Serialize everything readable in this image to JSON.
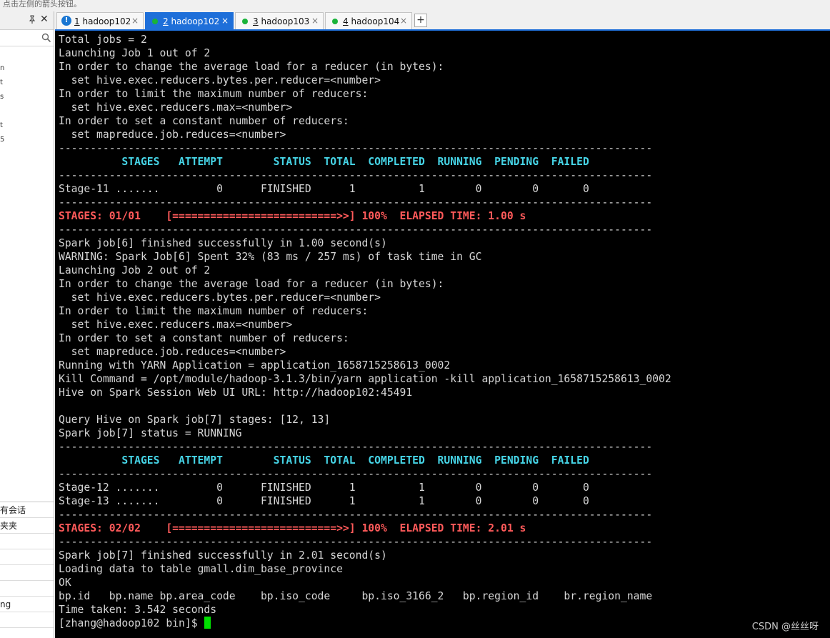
{
  "top_hint": "点击左侧的箭头按钮。",
  "sidebar": {
    "pin_glyph": "📌",
    "close_glyph": "✕",
    "search_icon": "search-icon",
    "side_marks": [
      "n",
      "t",
      "s",
      "",
      "t",
      "5"
    ],
    "bottom_rows": [
      "有会话",
      "夹夹",
      "",
      "",
      "",
      "",
      "ng",
      ""
    ]
  },
  "tabs": [
    {
      "number": "1",
      "name": "hadoop102",
      "status": "warning",
      "active": false
    },
    {
      "number": "2",
      "name": "hadoop102",
      "status": "connected",
      "active": true
    },
    {
      "number": "3",
      "name": "hadoop103",
      "status": "connected",
      "active": false
    },
    {
      "number": "4",
      "name": "hadoop104",
      "status": "connected",
      "active": false
    }
  ],
  "tab_add_label": "+",
  "tab_close_glyph": "×",
  "colors": {
    "terminal_bg": "#000000",
    "terminal_text": "#d6d6d6",
    "header_text": "#46d4e6",
    "progress_text": "#ff5a5a",
    "cursor": "#00e000",
    "active_tab": "#1e6fd9",
    "connected_dot": "#19b33a"
  },
  "terminal": {
    "lines": [
      {
        "text": "Total jobs = 2",
        "style": "normal"
      },
      {
        "text": "Launching Job 1 out of 2",
        "style": "normal"
      },
      {
        "text": "In order to change the average load for a reducer (in bytes):",
        "style": "normal"
      },
      {
        "text": "  set hive.exec.reducers.bytes.per.reducer=<number>",
        "style": "normal"
      },
      {
        "text": "In order to limit the maximum number of reducers:",
        "style": "normal"
      },
      {
        "text": "  set hive.exec.reducers.max=<number>",
        "style": "normal"
      },
      {
        "text": "In order to set a constant number of reducers:",
        "style": "normal"
      },
      {
        "text": "  set mapreduce.job.reduces=<number>",
        "style": "normal"
      },
      {
        "text": "----------------------------------------------------------------------------------------------",
        "style": "normal"
      },
      {
        "text": "          STAGES   ATTEMPT        STATUS  TOTAL  COMPLETED  RUNNING  PENDING  FAILED",
        "style": "head"
      },
      {
        "text": "----------------------------------------------------------------------------------------------",
        "style": "normal"
      },
      {
        "text": "Stage-11 .......         0      FINISHED      1          1        0        0       0",
        "style": "normal"
      },
      {
        "text": "----------------------------------------------------------------------------------------------",
        "style": "normal"
      },
      {
        "text": "STAGES: 01/01    [==========================>>] 100%  ELAPSED TIME: 1.00 s",
        "style": "prog"
      },
      {
        "text": "----------------------------------------------------------------------------------------------",
        "style": "normal"
      },
      {
        "text": "Spark job[6] finished successfully in 1.00 second(s)",
        "style": "normal"
      },
      {
        "text": "WARNING: Spark Job[6] Spent 32% (83 ms / 257 ms) of task time in GC",
        "style": "normal"
      },
      {
        "text": "Launching Job 2 out of 2",
        "style": "normal"
      },
      {
        "text": "In order to change the average load for a reducer (in bytes):",
        "style": "normal"
      },
      {
        "text": "  set hive.exec.reducers.bytes.per.reducer=<number>",
        "style": "normal"
      },
      {
        "text": "In order to limit the maximum number of reducers:",
        "style": "normal"
      },
      {
        "text": "  set hive.exec.reducers.max=<number>",
        "style": "normal"
      },
      {
        "text": "In order to set a constant number of reducers:",
        "style": "normal"
      },
      {
        "text": "  set mapreduce.job.reduces=<number>",
        "style": "normal"
      },
      {
        "text": "Running with YARN Application = application_1658715258613_0002",
        "style": "normal"
      },
      {
        "text": "Kill Command = /opt/module/hadoop-3.1.3/bin/yarn application -kill application_1658715258613_0002",
        "style": "normal"
      },
      {
        "text": "Hive on Spark Session Web UI URL: http://hadoop102:45491",
        "style": "normal"
      },
      {
        "text": "",
        "style": "normal"
      },
      {
        "text": "Query Hive on Spark job[7] stages: [12, 13]",
        "style": "normal"
      },
      {
        "text": "Spark job[7] status = RUNNING",
        "style": "normal"
      },
      {
        "text": "----------------------------------------------------------------------------------------------",
        "style": "normal"
      },
      {
        "text": "          STAGES   ATTEMPT        STATUS  TOTAL  COMPLETED  RUNNING  PENDING  FAILED",
        "style": "head"
      },
      {
        "text": "----------------------------------------------------------------------------------------------",
        "style": "normal"
      },
      {
        "text": "Stage-12 .......         0      FINISHED      1          1        0        0       0",
        "style": "normal"
      },
      {
        "text": "Stage-13 .......         0      FINISHED      1          1        0        0       0",
        "style": "normal"
      },
      {
        "text": "----------------------------------------------------------------------------------------------",
        "style": "normal"
      },
      {
        "text": "STAGES: 02/02    [==========================>>] 100%  ELAPSED TIME: 2.01 s",
        "style": "prog"
      },
      {
        "text": "----------------------------------------------------------------------------------------------",
        "style": "normal"
      },
      {
        "text": "Spark job[7] finished successfully in 2.01 second(s)",
        "style": "normal"
      },
      {
        "text": "Loading data to table gmall.dim_base_province",
        "style": "normal"
      },
      {
        "text": "OK",
        "style": "normal"
      },
      {
        "text": "bp.id   bp.name bp.area_code    bp.iso_code     bp.iso_3166_2   bp.region_id    br.region_name",
        "style": "normal"
      },
      {
        "text": "Time taken: 3.542 seconds",
        "style": "normal"
      }
    ],
    "prompt": "[zhang@hadoop102 bin]$ "
  },
  "watermark": "CSDN @丝丝呀"
}
